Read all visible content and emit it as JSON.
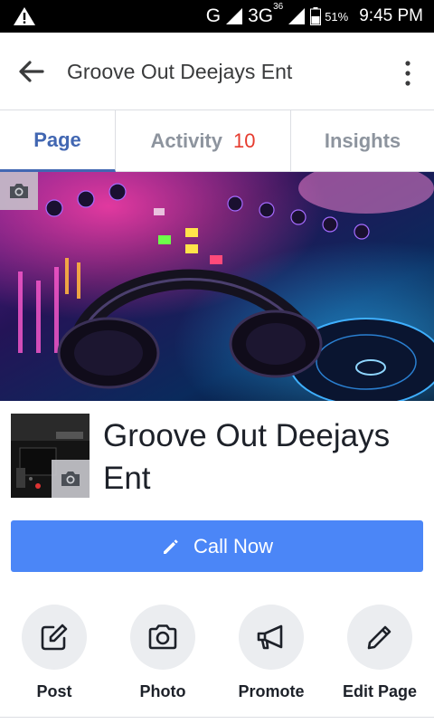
{
  "status_bar": {
    "network_g": "G",
    "network_3g": "3G",
    "network_3g_sup": "36",
    "battery": "51%",
    "time": "9:45 PM"
  },
  "header": {
    "title": "Groove Out Deejays Ent"
  },
  "tabs": [
    {
      "label": "Page",
      "active": true
    },
    {
      "label": "Activity",
      "badge": "10",
      "active": false
    },
    {
      "label": "Insights",
      "active": false
    }
  ],
  "profile": {
    "name": "Groove Out Deejays Ent"
  },
  "call_button": {
    "label": "Call Now",
    "icon": "pencil-icon",
    "color": "#4b86f7"
  },
  "actions": [
    {
      "label": "Post",
      "icon": "compose-icon"
    },
    {
      "label": "Photo",
      "icon": "camera-icon"
    },
    {
      "label": "Promote",
      "icon": "megaphone-icon"
    },
    {
      "label": "Edit Page",
      "icon": "pencil-icon"
    }
  ],
  "colors": {
    "accent": "#4267b2",
    "badge": "#e63b2e",
    "tab_inactive": "#8d949e"
  }
}
